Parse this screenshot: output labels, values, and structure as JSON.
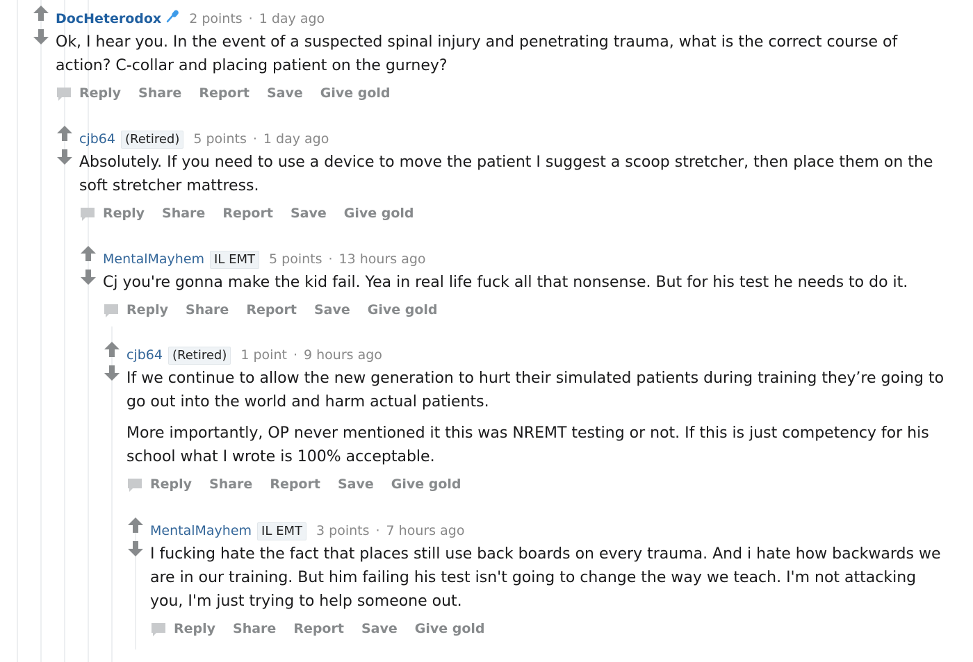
{
  "colors": {
    "author_link": "#336699",
    "op_author": "#1f5fa0",
    "action_gray": "#878a8c",
    "vote_gray": "#878a8c",
    "flair_bg": "#eff3f6"
  },
  "icons": {
    "upvote": "arrow-up-icon",
    "downvote": "arrow-down-icon",
    "reply": "speech-bubble-icon",
    "moderator": "microphone-icon"
  },
  "comments": [
    {
      "author": "DocHeterodox",
      "flair": "",
      "points": "2 points",
      "separator": "·",
      "time": "1 day ago",
      "paragraphs": [
        "Ok, I hear you. In the event of a suspected spinal injury and penetrating trauma, what is the correct course of action? C-collar and placing patient on the gurney?"
      ],
      "actions": [
        "Reply",
        "Share",
        "Report",
        "Save",
        "Give gold"
      ]
    },
    {
      "author": "cjb64",
      "flair": "(Retired)",
      "points": "5 points",
      "separator": "·",
      "time": "1 day ago",
      "paragraphs": [
        "Absolutely. If you need to use a device to move the patient I suggest a scoop stretcher, then place them on the soft stretcher mattress."
      ],
      "actions": [
        "Reply",
        "Share",
        "Report",
        "Save",
        "Give gold"
      ]
    },
    {
      "author": "MentalMayhem",
      "flair": "IL EMT",
      "points": "5 points",
      "separator": "·",
      "time": "13 hours ago",
      "paragraphs": [
        "Cj you're gonna make the kid fail. Yea in real life fuck all that nonsense. But for his test he needs to do it."
      ],
      "actions": [
        "Reply",
        "Share",
        "Report",
        "Save",
        "Give gold"
      ]
    },
    {
      "author": "cjb64",
      "flair": "(Retired)",
      "points": "1 point",
      "separator": "·",
      "time": "9 hours ago",
      "paragraphs": [
        "If we continue to allow the new generation to hurt their simulated patients during training they’re going to go out into the world and harm actual patients.",
        "More importantly, OP never mentioned it this was NREMT testing or not. If this is just competency for his school what I wrote is 100% acceptable."
      ],
      "actions": [
        "Reply",
        "Share",
        "Report",
        "Save",
        "Give gold"
      ]
    },
    {
      "author": "MentalMayhem",
      "flair": "IL EMT",
      "points": "3 points",
      "separator": "·",
      "time": "7 hours ago",
      "paragraphs": [
        "I fucking hate the fact that places still use back boards on every trauma. And i hate how backwards we are in our training. But him failing his test isn't going to change the way we teach. I'm not attacking you, I'm just trying to help someone out."
      ],
      "actions": [
        "Reply",
        "Share",
        "Report",
        "Save",
        "Give gold"
      ]
    }
  ]
}
